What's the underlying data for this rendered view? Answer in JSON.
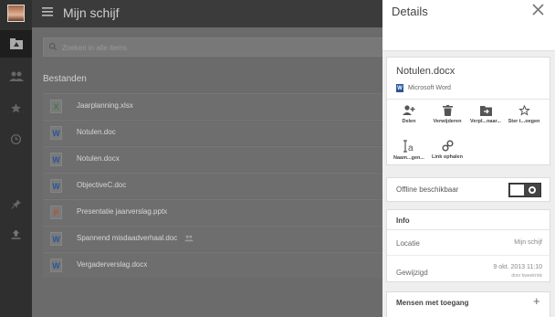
{
  "header": {
    "title": "Mijn schijf"
  },
  "nav": {
    "items": [
      {
        "name": "my-drive",
        "icon": "drive-icon"
      },
      {
        "name": "shared",
        "icon": "people-icon"
      },
      {
        "name": "starred",
        "icon": "star-icon"
      },
      {
        "name": "recent",
        "icon": "clock-icon"
      },
      {
        "name": "pinned",
        "icon": "pin-icon"
      },
      {
        "name": "upload",
        "icon": "upload-icon"
      }
    ]
  },
  "search": {
    "placeholder": "Zoeken in alle items"
  },
  "files_section": {
    "label": "Bestanden"
  },
  "files": [
    {
      "name": "Jaarplanning.xlsx",
      "type": "X",
      "color": "#3d7a4a",
      "shared": false
    },
    {
      "name": "Notulen.doc",
      "type": "W",
      "color": "#2a5699",
      "shared": false
    },
    {
      "name": "Notulen.docx",
      "type": "W",
      "color": "#2a5699",
      "shared": false
    },
    {
      "name": "ObjectiveC.doc",
      "type": "W",
      "color": "#2a5699",
      "shared": false
    },
    {
      "name": "Presentatie jaarverslag.pptx",
      "type": "P",
      "color": "#b5552c",
      "shared": false
    },
    {
      "name": "Spannend misdaadverhaal.doc",
      "type": "W",
      "color": "#2a5699",
      "shared": true
    },
    {
      "name": "Vergaderverslag.docx",
      "type": "W",
      "color": "#2a5699",
      "shared": false
    }
  ],
  "details": {
    "title": "Details",
    "file_name": "Notulen.docx",
    "file_type": "Microsoft Word",
    "file_type_icon": "W",
    "actions": [
      {
        "label": "Delen",
        "icon": "add-person-icon"
      },
      {
        "label": "Verwijderen",
        "icon": "trash-icon"
      },
      {
        "label": "Verpl...naar...",
        "icon": "move-folder-icon"
      },
      {
        "label": "Ster t...oegen",
        "icon": "star-outline-icon"
      },
      {
        "label": "Naam...gen...",
        "icon": "rename-icon"
      },
      {
        "label": "Link ophalen",
        "icon": "link-icon"
      }
    ],
    "offline": {
      "label": "Offline beschikbaar",
      "enabled": false
    },
    "info": {
      "header": "Info",
      "location_label": "Locatie",
      "location_value": "Mijn schijf",
      "modified_label": "Gewijzigd",
      "modified_value": "9 okt. 2013 11:10",
      "modified_by": "door kweekrink"
    },
    "people": {
      "label": "Mensen met toegang",
      "add": "+"
    }
  }
}
